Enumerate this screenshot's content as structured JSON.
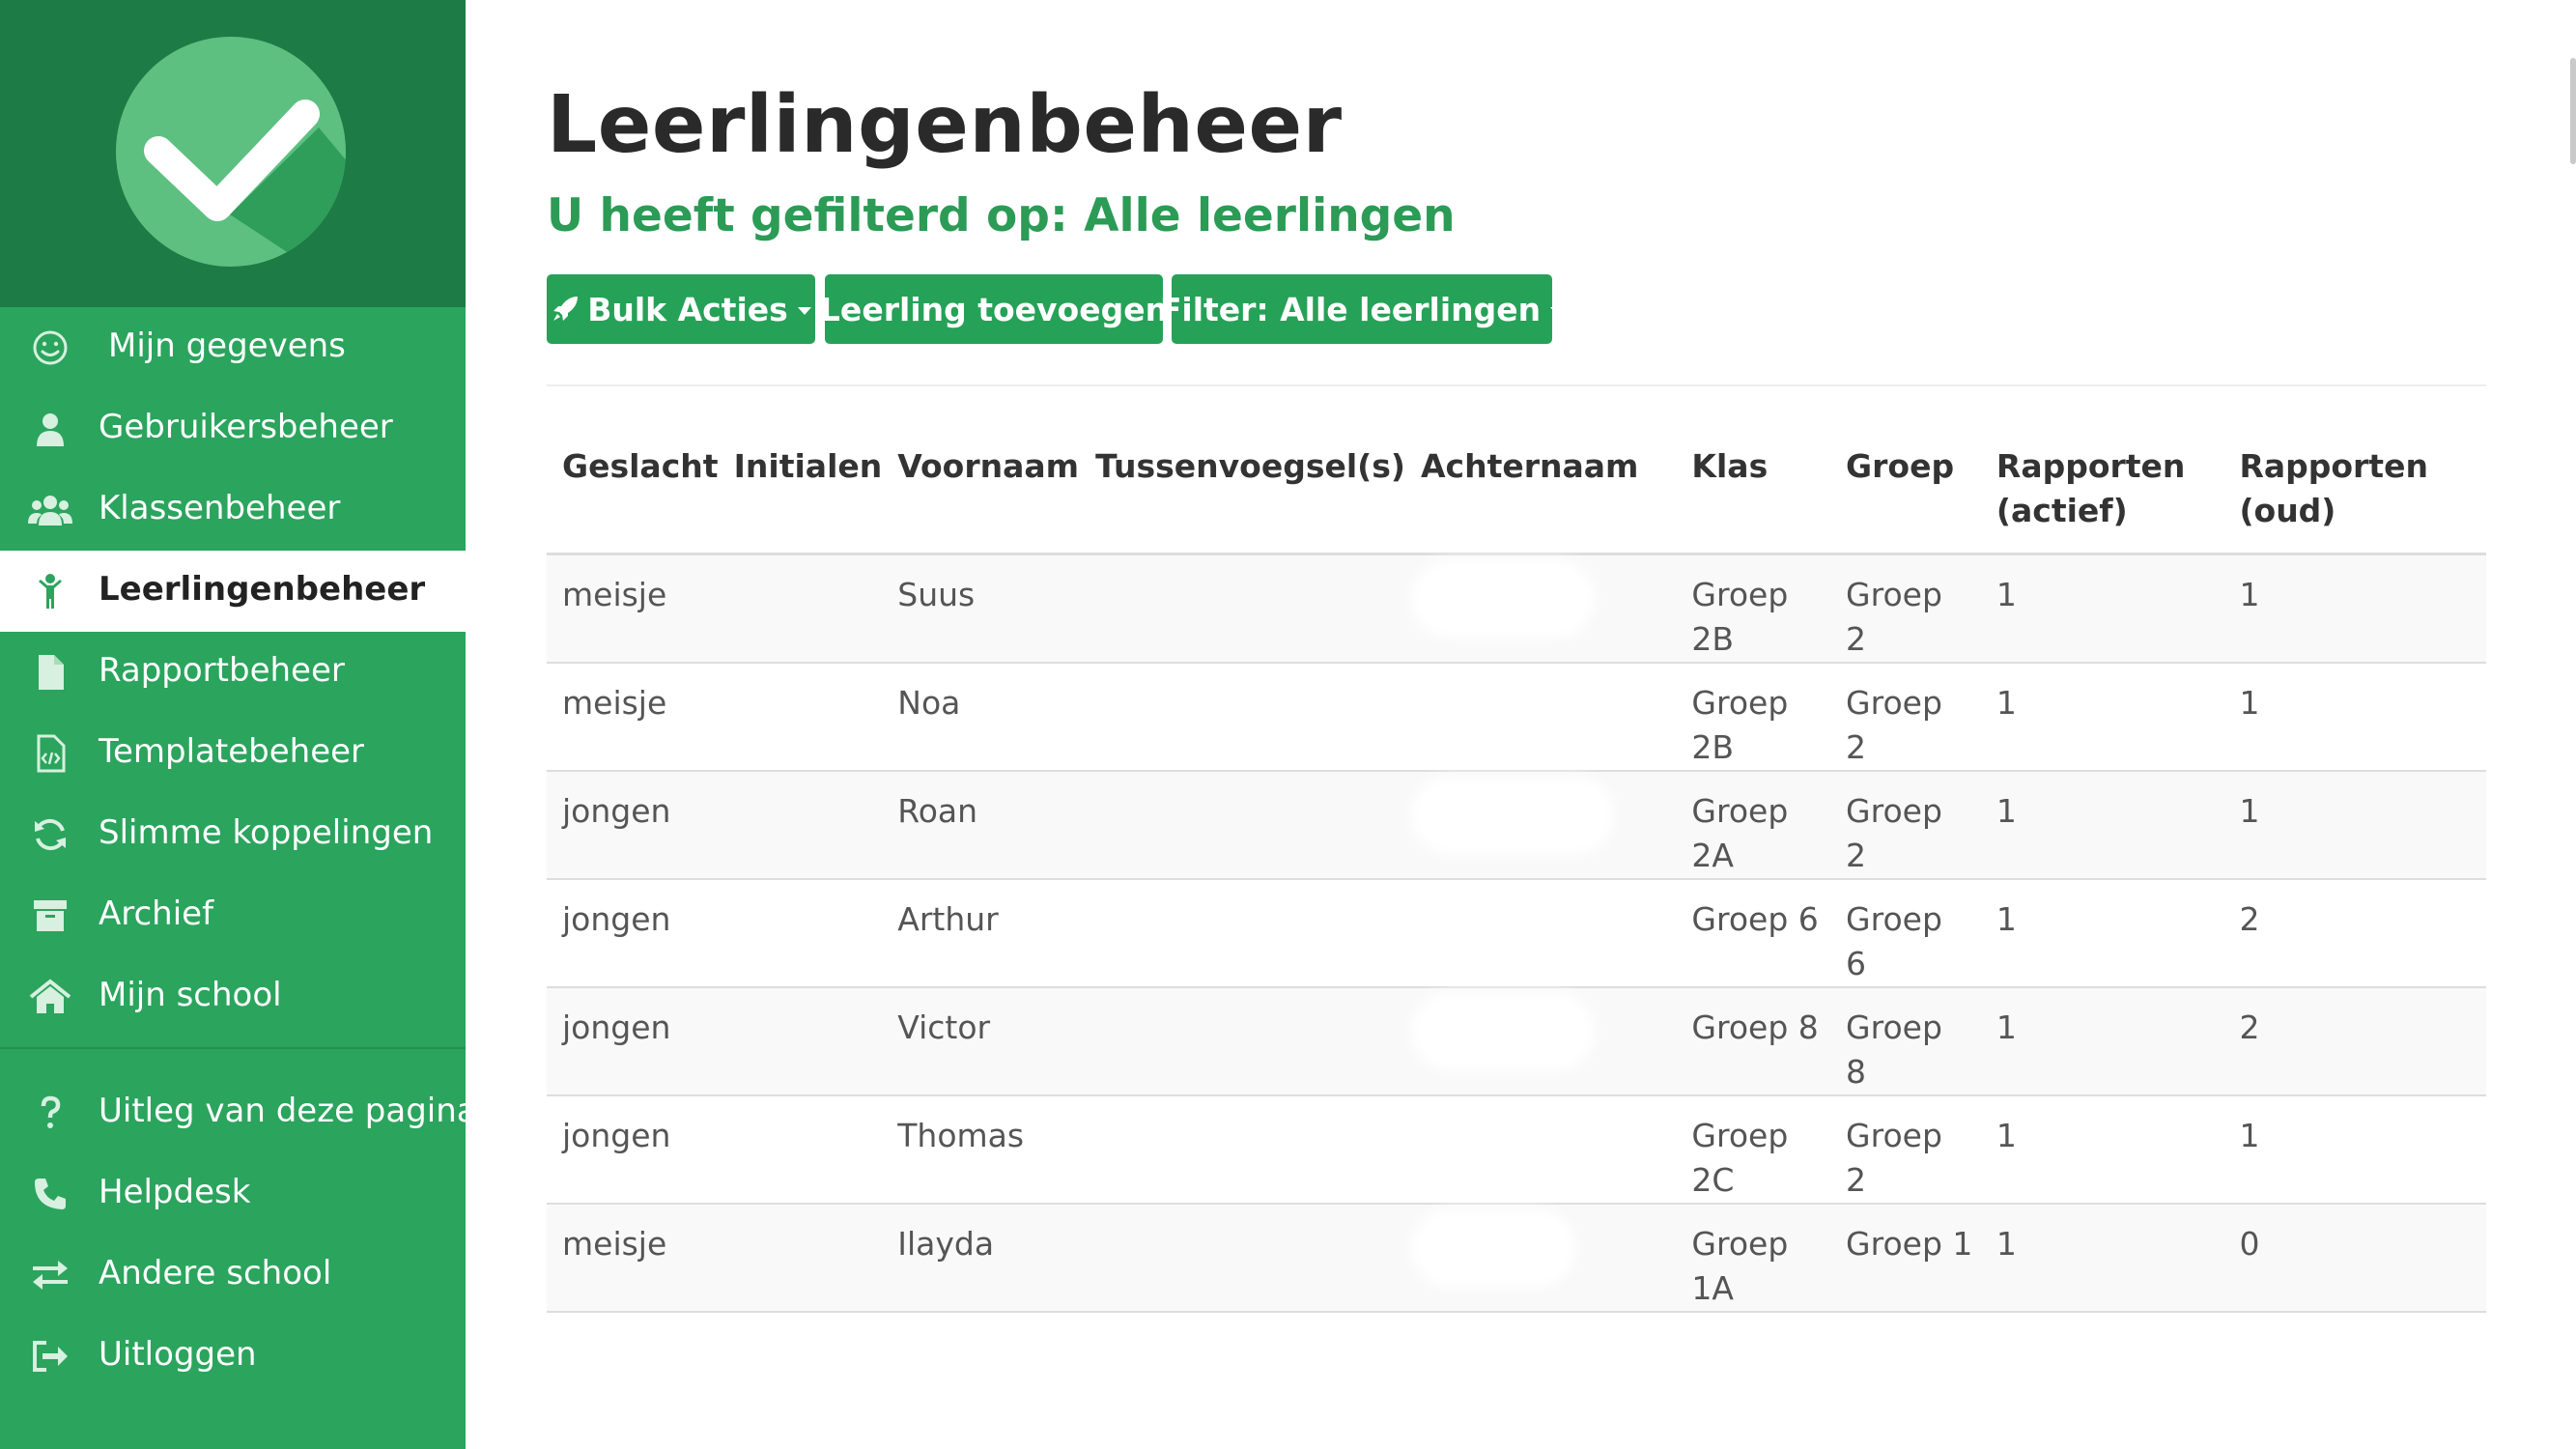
{
  "sidebar": {
    "logo_icon": "checkmark-logo",
    "items": [
      {
        "label": "Mijn gegevens",
        "icon": "smiley-icon"
      },
      {
        "label": "Gebruikersbeheer",
        "icon": "user-icon"
      },
      {
        "label": "Klassenbeheer",
        "icon": "users-group-icon"
      },
      {
        "label": "Leerlingenbeheer",
        "icon": "child-icon",
        "active": true
      },
      {
        "label": "Rapportbeheer",
        "icon": "file-icon"
      },
      {
        "label": "Templatebeheer",
        "icon": "file-code-icon"
      },
      {
        "label": "Slimme koppelingen",
        "icon": "refresh-icon"
      },
      {
        "label": "Archief",
        "icon": "archive-icon"
      },
      {
        "label": "Mijn school",
        "icon": "home-icon"
      }
    ],
    "bottom_items": [
      {
        "label": "Uitleg van deze pagina",
        "icon": "question-icon"
      },
      {
        "label": "Helpdesk",
        "icon": "phone-icon"
      },
      {
        "label": "Andere school",
        "icon": "exchange-icon"
      },
      {
        "label": "Uitloggen",
        "icon": "sign-out-icon"
      }
    ]
  },
  "main": {
    "title": "Leerlingenbeheer",
    "subtitle": "U heeft gefilterd op: Alle leerlingen",
    "buttons": {
      "bulk": "Bulk Acties",
      "add": "Leerling toevoegen",
      "filter": "Filter: Alle leerlingen"
    },
    "table": {
      "headers": {
        "geslacht": "Geslacht",
        "initialen": "Initialen",
        "voornaam": "Voornaam",
        "tussenvoegsel": "Tussenvoegsel(s)",
        "achternaam": "Achternaam",
        "klas": "Klas",
        "groep": "Groep",
        "rapporten_actief": "Rapporten (actief)",
        "rapporten_oud": "Rapporten (oud)"
      },
      "rows": [
        {
          "geslacht": "meisje",
          "initialen": "",
          "voornaam": "Suus",
          "tussenvoegsel": "",
          "achternaam": "",
          "klas": "Groep 2B",
          "groep": "Groep 2",
          "actief": "1",
          "oud": "1"
        },
        {
          "geslacht": "meisje",
          "initialen": "",
          "voornaam": "Noa",
          "tussenvoegsel": "",
          "achternaam": "",
          "klas": "Groep 2B",
          "groep": "Groep 2",
          "actief": "1",
          "oud": "1"
        },
        {
          "geslacht": "jongen",
          "initialen": "",
          "voornaam": "Roan",
          "tussenvoegsel": "",
          "achternaam": "",
          "klas": "Groep 2A",
          "groep": "Groep 2",
          "actief": "1",
          "oud": "1"
        },
        {
          "geslacht": "jongen",
          "initialen": "",
          "voornaam": "Arthur",
          "tussenvoegsel": "",
          "achternaam": "",
          "klas": "Groep 6",
          "groep": "Groep 6",
          "actief": "1",
          "oud": "2"
        },
        {
          "geslacht": "jongen",
          "initialen": "",
          "voornaam": "Victor",
          "tussenvoegsel": "",
          "achternaam": "",
          "klas": "Groep 8",
          "groep": "Groep 8",
          "actief": "1",
          "oud": "2"
        },
        {
          "geslacht": "jongen",
          "initialen": "",
          "voornaam": "Thomas",
          "tussenvoegsel": "",
          "achternaam": "",
          "klas": "Groep 2C",
          "groep": "Groep 2",
          "actief": "1",
          "oud": "1"
        },
        {
          "geslacht": "meisje",
          "initialen": "",
          "voornaam": "Ilayda",
          "tussenvoegsel": "",
          "achternaam": "",
          "klas": "Groep 1A",
          "groep": "Groep 1",
          "actief": "1",
          "oud": "0"
        }
      ]
    }
  },
  "colors": {
    "sidebar": "#2ba45d",
    "logo_bg": "#1d7b46",
    "accent": "#26a158",
    "subtitle": "#2b9b56"
  }
}
